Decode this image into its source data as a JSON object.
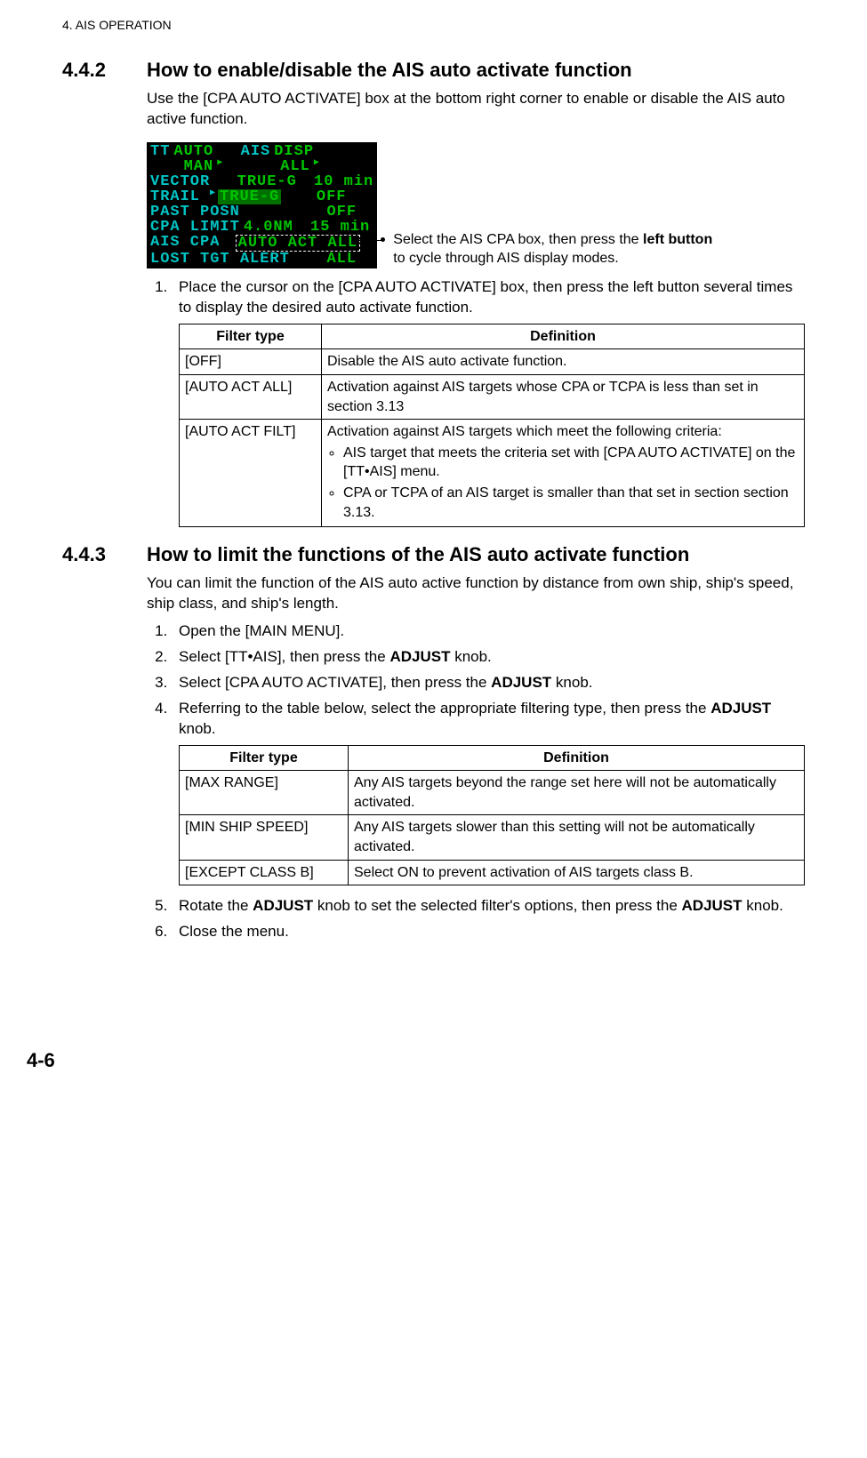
{
  "chapter_header": "4.  AIS OPERATION",
  "page_number": "4-6",
  "s442": {
    "num": "4.4.2",
    "title": "How to enable/disable the AIS auto activate function",
    "intro": "Use the [CPA AUTO ACTIVATE] box at the bottom right corner to enable or disable the AIS auto active function.",
    "callout_pre": "Select the AIS CPA box, then press the ",
    "callout_bold": "left button",
    "callout_post": " to cycle through AIS display modes.",
    "step1": "Place the cursor on the [CPA AUTO ACTIVATE] box, then press the left button several times to display the desired auto activate function.",
    "th_filter": "Filter type",
    "th_def": "Definition",
    "rows": {
      "r0c0": "[OFF]",
      "r0c1": "Disable the AIS auto activate function.",
      "r1c0": "[AUTO ACT ALL]",
      "r1c1": "Activation against AIS targets whose CPA or TCPA is less than set in section 3.13",
      "r2c0": "[AUTO ACT FILT]",
      "r2c1_lead": "Activation against AIS targets which meet the following criteria:",
      "r2c1_b1": "AIS target that meets the criteria set with [CPA AUTO ACTIVATE] on the [TT•AIS] menu.",
      "r2c1_b2": "CPA or TCPA of an AIS target is smaller than that set in section section 3.13."
    }
  },
  "panel": {
    "r0a": "TT",
    "r0b": "AUTO",
    "r0c": "AIS",
    "r0d": "DISP",
    "r1a": "MAN",
    "r1b": "ALL",
    "r2a": "VECTOR",
    "r2b": "TRUE-G",
    "r2c": "10 min",
    "r3a": "TRAIL",
    "r3b": "TRUE-G",
    "r3c": "OFF",
    "r4a": "PAST POSN",
    "r4c": "OFF",
    "r5a": "CPA LIMIT",
    "r5b": "4.0NM",
    "r5c": "15 min",
    "r6a": "AIS CPA",
    "r6b": "AUTO ACT ALL",
    "r7a": "LOST TGT ALERT",
    "r7b": "ALL"
  },
  "s443": {
    "num": "4.4.3",
    "title": "How to limit the functions of the AIS auto activate function",
    "intro": "You can limit the function of the AIS auto active function by distance from own ship, ship's speed, ship class, and ship's length.",
    "step1": "Open the [MAIN MENU].",
    "step2_pre": "Select [TT•AIS], then press the ",
    "step2_bold": "ADJUST",
    "step2_post": " knob.",
    "step3_pre": "Select [CPA AUTO ACTIVATE], then press the ",
    "step3_bold": "ADJUST",
    "step3_post": " knob.",
    "step4_pre": "Referring to the table below, select the appropriate filtering type, then press the ",
    "step4_bold": "ADJUST",
    "step4_post": " knob.",
    "th_filter": "Filter type",
    "th_def": "Definition",
    "rows": {
      "r0c0": "[MAX RANGE]",
      "r0c1": "Any AIS targets beyond the range set here will not be automatically activated.",
      "r1c0": "[MIN SHIP SPEED]",
      "r1c1": "Any AIS targets slower than this setting will not be automatically activated.",
      "r2c0": "[EXCEPT CLASS B]",
      "r2c1": "Select ON to prevent activation of AIS targets class B."
    },
    "step5_pre": "Rotate the ",
    "step5_bold1": "ADJUST",
    "step5_mid": " knob to set the selected filter's options, then press the ",
    "step5_bold2": "ADJUST",
    "step5_post": " knob.",
    "step6": "Close the menu."
  }
}
